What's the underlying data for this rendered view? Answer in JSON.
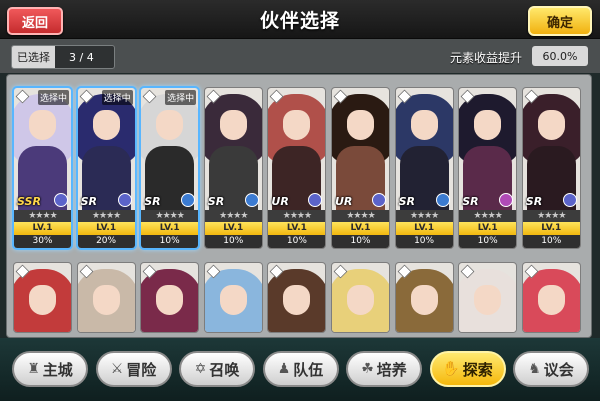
{
  "header": {
    "back_label": "返回",
    "title": "伙伴选择",
    "confirm_label": "确定"
  },
  "selection": {
    "label": "已选择",
    "count": "3 / 4"
  },
  "bonus": {
    "label": "元素收益提升",
    "value": "60.0%"
  },
  "stars_text": "★★★★",
  "selected_tag": "选择中",
  "cards": [
    {
      "rarity": "SSR",
      "level": "LV.1",
      "bonus": "30%",
      "selected": true,
      "hair": "#cfc7e8",
      "outfit": "#4b3a7a",
      "class_icon": "#5b63c9"
    },
    {
      "rarity": "SR",
      "level": "LV.1",
      "bonus": "20%",
      "selected": true,
      "hair": "#2a2b6e",
      "outfit": "#2b2b55",
      "class_icon": "#5b63c9"
    },
    {
      "rarity": "SR",
      "level": "LV.1",
      "bonus": "10%",
      "selected": true,
      "hair": "#d6d6d6",
      "outfit": "#2a2a2a",
      "class_icon": "#3b7bd1"
    },
    {
      "rarity": "SR",
      "level": "LV.1",
      "bonus": "10%",
      "selected": false,
      "hair": "#3a2a3a",
      "outfit": "#3a3a3a",
      "class_icon": "#3b7bd1"
    },
    {
      "rarity": "UR",
      "level": "LV.1",
      "bonus": "10%",
      "selected": false,
      "hair": "#b0504a",
      "outfit": "#3d2525",
      "class_icon": "#5b63c9"
    },
    {
      "rarity": "UR",
      "level": "LV.1",
      "bonus": "10%",
      "selected": false,
      "hair": "#2a1a12",
      "outfit": "#7a4a3a",
      "class_icon": "#5b63c9"
    },
    {
      "rarity": "SR",
      "level": "LV.1",
      "bonus": "10%",
      "selected": false,
      "hair": "#2c3866",
      "outfit": "#222233",
      "class_icon": "#3b7bd1"
    },
    {
      "rarity": "SR",
      "level": "LV.1",
      "bonus": "10%",
      "selected": false,
      "hair": "#1e1a2e",
      "outfit": "#5a2a4a",
      "class_icon": "#b04ab7"
    },
    {
      "rarity": "SR",
      "level": "LV.1",
      "bonus": "10%",
      "selected": false,
      "hair": "#3a1f2a",
      "outfit": "#2a1a20",
      "class_icon": "#5b63c9"
    }
  ],
  "cards_row2": [
    {
      "hair": "#c23b3b"
    },
    {
      "hair": "#c9b9a8"
    },
    {
      "hair": "#7a2a4a"
    },
    {
      "hair": "#8ab6dd"
    },
    {
      "hair": "#5a3a2a"
    },
    {
      "hair": "#e8d07a"
    },
    {
      "hair": "#8a6a3a"
    },
    {
      "hair": "#e8e0dc"
    },
    {
      "hair": "#d94a5a"
    }
  ],
  "nav": [
    {
      "label": "主城",
      "icon": "castle-icon",
      "glyph": "♜",
      "active": false
    },
    {
      "label": "冒险",
      "icon": "crossed-swords-icon",
      "glyph": "⚔",
      "active": false
    },
    {
      "label": "召唤",
      "icon": "summon-circle-icon",
      "glyph": "✡",
      "active": false
    },
    {
      "label": "队伍",
      "icon": "team-icon",
      "glyph": "♟",
      "active": false
    },
    {
      "label": "培养",
      "icon": "train-icon",
      "glyph": "☘",
      "active": false
    },
    {
      "label": "探索",
      "icon": "explore-icon",
      "glyph": "✋",
      "active": true
    },
    {
      "label": "议会",
      "icon": "council-icon",
      "glyph": "♞",
      "active": false
    }
  ]
}
